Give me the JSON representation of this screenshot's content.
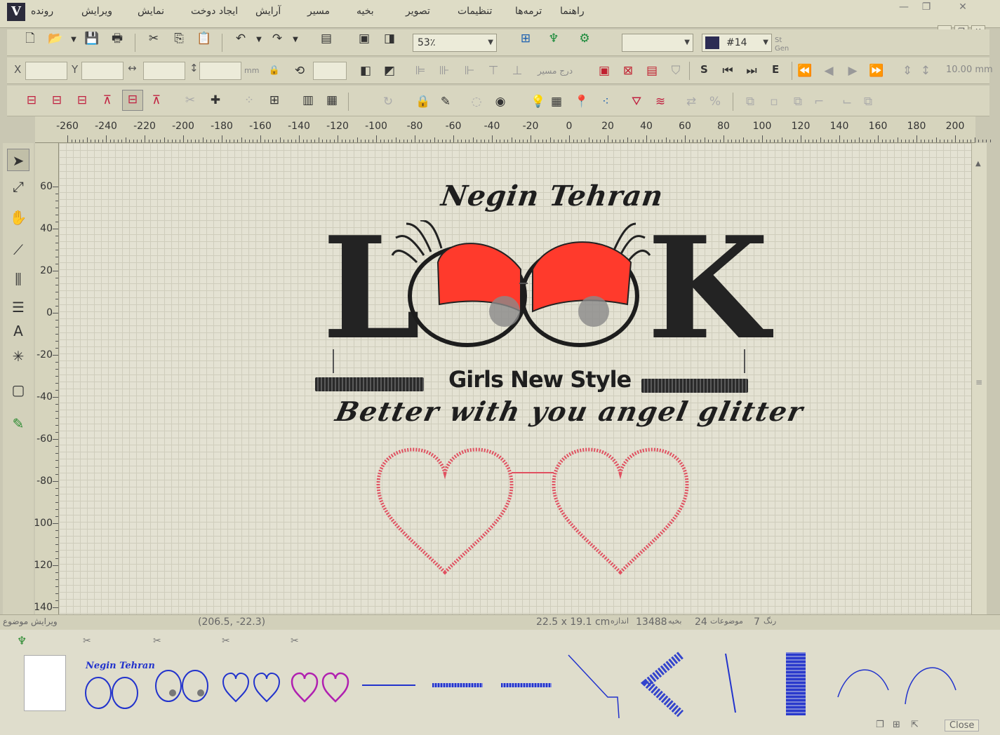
{
  "menu": {
    "items": [
      "راهنما",
      "ترمه‌ها",
      "تنظیمات",
      "تصویر",
      "بخیه",
      "مسیر",
      "آرایش",
      "ایجاد دوخت",
      "نمایش",
      "ویرایش",
      "رونده"
    ]
  },
  "toolbar": {
    "zoom_value": "53٪",
    "color_value": "#14",
    "color_swatch": "#2c2c54",
    "route_label": "درج مسیر",
    "x_label": "X",
    "y_label": "Y",
    "unit_label": "mm",
    "s_label": "S",
    "e_label": "E",
    "spacing_value": "10.00 mm",
    "stgen_label": "St Gen"
  },
  "ruler": {
    "unit": "mm",
    "h_ticks": [
      "-260",
      "-240",
      "-220",
      "-200",
      "-180",
      "-160",
      "-140",
      "-120",
      "-100",
      "-80",
      "-60",
      "-40",
      "-20",
      "0",
      "20",
      "40",
      "60",
      "80",
      "100",
      "120",
      "140",
      "160",
      "180",
      "200"
    ],
    "v_ticks": [
      "60",
      "40",
      "20",
      "0",
      "-20",
      "-40",
      "-60",
      "-80",
      "-100",
      "-120",
      "-140"
    ]
  },
  "design": {
    "top_script": "Negin Tehran",
    "main_letter_l": "L",
    "main_letter_k": "K",
    "tagline": "Girls New Style",
    "slogan": "Better with you angel glitter",
    "eye_color": "#ff3a2c",
    "heart_color": "#e05060"
  },
  "status": {
    "left_label": "ویرایش موضوع",
    "coords": "(206.5, -22.3)",
    "size": "22.5 x 19.1 cm",
    "size_label": "اندازه",
    "stitches": "13488",
    "stitches_label": "بخیه",
    "objects": "24",
    "objects_label": "موضوعات",
    "colors": "7",
    "colors_label": "رنگ"
  },
  "strip": {
    "thumb_text": "Negin Tehran",
    "close_label": "Close"
  }
}
